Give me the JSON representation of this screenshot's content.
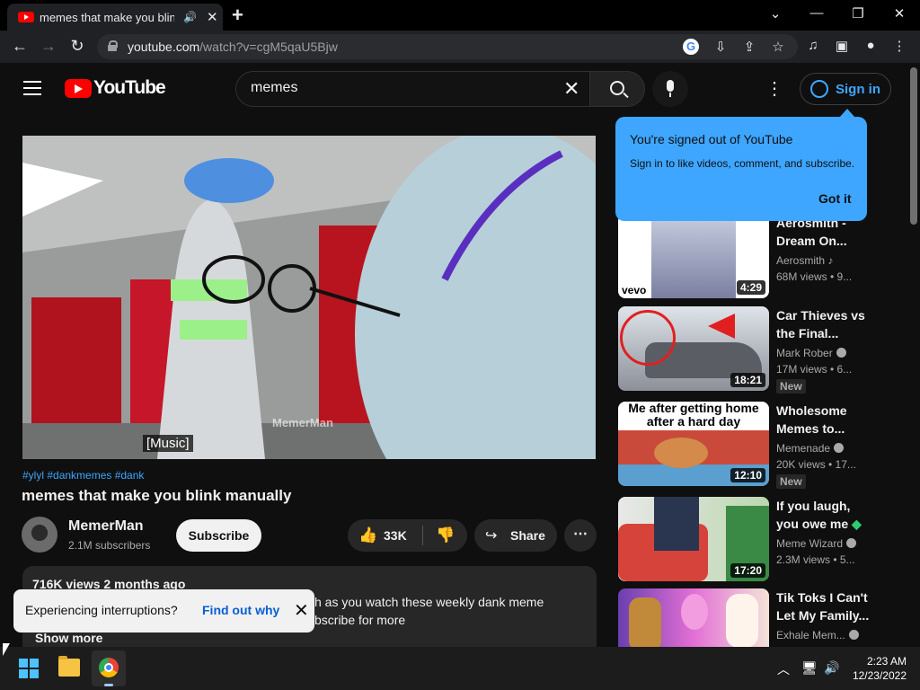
{
  "browser": {
    "tab_title": "memes that make you blink",
    "url_host": "youtube.com",
    "url_path": "/watch?v=cgM5qaU5Bjw"
  },
  "header": {
    "wordmark": "YouTube",
    "search_value": "memes",
    "signin_label": "Sign in"
  },
  "popup": {
    "title": "You're signed out of YouTube",
    "body": "Sign in to like videos, comment, and subscribe.",
    "button": "Got it"
  },
  "player": {
    "captions": "[Music]",
    "watermark": "MemerMan"
  },
  "video": {
    "hashtags": "#ylyl #dankmemes #dank",
    "title": "memes that make you blink manually",
    "channel": "MemerMan",
    "subscribers": "2.1M subscribers",
    "subscribe_label": "Subscribe",
    "likes": "33K",
    "share_label": "Share",
    "stats": "716K views  2 months ago",
    "desc_line1": "h as you watch these weekly dank meme",
    "desc_line2": "bscribe for more",
    "show_more": "Show more"
  },
  "toast": {
    "text": "Experiencing interruptions?",
    "link": "Find out why"
  },
  "recommendations": [
    {
      "title": "Aerosmith - Dream On...",
      "channel": "Aerosmith",
      "stats": "68M views • 9...",
      "duration": "4:29",
      "badge": "",
      "thumb_label": "vevo"
    },
    {
      "title": "Car Thieves vs the Final...",
      "channel": "Mark Rober",
      "stats": "17M views • 6...",
      "duration": "18:21",
      "badge": "New",
      "thumb_label": ""
    },
    {
      "title": "Wholesome Memes to...",
      "channel": "Memenade",
      "stats": "20K views • 17...",
      "duration": "12:10",
      "badge": "New",
      "thumb_label": "Me after getting home after a hard day"
    },
    {
      "title": "If you laugh, you owe me",
      "channel": "Meme Wizard",
      "stats": "2.3M views • 5...",
      "duration": "17:20",
      "badge": "",
      "thumb_label": ""
    },
    {
      "title": "Tik Toks I Can't Let My Family...",
      "channel": "Exhale Mem...",
      "stats": "",
      "duration": "",
      "badge": "",
      "thumb_label": ""
    }
  ],
  "taskbar": {
    "time": "2:23 AM",
    "date": "12/23/2022"
  }
}
